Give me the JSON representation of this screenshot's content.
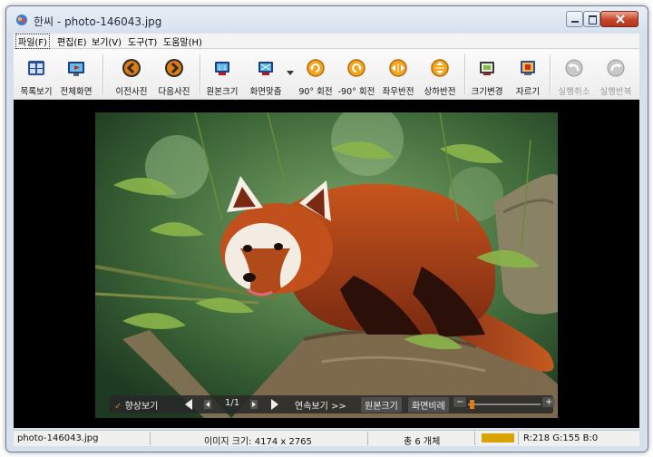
{
  "window": {
    "app": "한씨",
    "file": "photo-146043.jpg",
    "title_sep": " - "
  },
  "menu": [
    {
      "label": "파일(F)"
    },
    {
      "label": "편집(E)"
    },
    {
      "label": "보기(V)"
    },
    {
      "label": "도구(T)"
    },
    {
      "label": "도움말(H)"
    }
  ],
  "toolbar": {
    "list_view": "목록보기",
    "full_screen": "전체화면",
    "prev_photo": "이전사진",
    "next_photo": "다음사진",
    "original_size": "원본크기",
    "fit_screen": "화면맞춤",
    "rotate_cw": "90° 회전",
    "rotate_ccw": "-90° 회전",
    "flip_horizontal": "좌우반전",
    "flip_vertical": "상하반전",
    "resize": "크기변경",
    "crop": "자르기",
    "undo": "실행취소",
    "redo": "실행반복"
  },
  "overlay": {
    "enhance": "향상보기",
    "page_counter": "1/1",
    "slideshow": "연속보기 >>",
    "original_size": "원본크기",
    "fit_ratio": "화면비례",
    "zoom_minus": "−",
    "zoom_plus": "+"
  },
  "status": {
    "filename": "photo-146043.jpg",
    "image_size": "이미지 크기: 4174 x 2765",
    "count": "총 6 개체",
    "color_swatch": "#d9a400",
    "rgb": "R:218 G:155 B:0"
  },
  "colors": {
    "accent_orange": "#e07b12",
    "viewer_bg": "#000000"
  }
}
